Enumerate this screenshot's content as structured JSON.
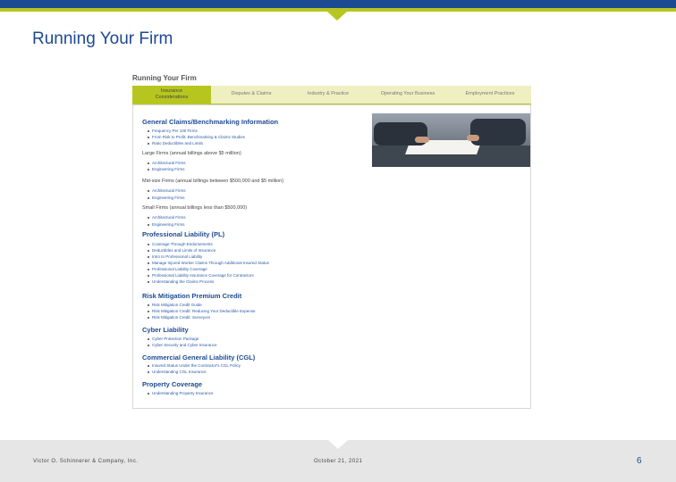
{
  "slide": {
    "title": "Running Your Firm",
    "footer_company": "Victor O. Schinnerer & Company, Inc.",
    "footer_date": "October 21, 2021",
    "page_number": "6"
  },
  "screenshot": {
    "heading": "Running Your Firm",
    "tabs": [
      {
        "label": "Insurance Considerations"
      },
      {
        "label": "Disputes & Claims"
      },
      {
        "label": "Industry & Practice"
      },
      {
        "label": "Operating Your Business"
      },
      {
        "label": "Employment Practices"
      }
    ],
    "sections": {
      "general_claims": {
        "title": "General Claims/Benchmarking Information",
        "items": [
          "Frequency Per 100 Firms",
          "From Risk to Profit: Benchmarking & Claims Studies",
          "Ratio Deductibles and Limits"
        ]
      },
      "large_firms": {
        "title": "Large Firms (annual billings above $5 million)",
        "items": [
          "Architectural Firms",
          "Engineering Firms"
        ]
      },
      "mid_firms": {
        "title": "Mid-size Firms (annual billings between $500,000 and $5 million)",
        "items": [
          "Architectural Firms",
          "Engineering Firms"
        ]
      },
      "small_firms": {
        "title": "Small Firms (annual billings less than $500,000)",
        "items": [
          "Architectural Firms",
          "Engineering Firms"
        ]
      },
      "professional_liability": {
        "title": "Professional Liability (PL)",
        "items": [
          "Coverage Through Endorsements",
          "Deductibles and Limits of Insurance",
          "Intro to Professional Liability",
          "Manage Injured Worker Claims Through Additional Insured Status",
          "Professional Liability Coverage",
          "Professional Liability Insurance Coverage for Contractors",
          "Understanding the Claims Process"
        ]
      },
      "risk_mitigation": {
        "title": "Risk Mitigation Premium Credit",
        "items": [
          "Risk Mitigation Credit Guide",
          "Risk Mitigation Credit: Reducing Your Deductible Expense",
          "Risk Mitigation Credit: Surveyors"
        ]
      },
      "cyber": {
        "title": "Cyber Liability",
        "items": [
          "Cyber Protection Package",
          "Cyber Security and Cyber Insurance"
        ]
      },
      "cgl": {
        "title": "Commercial General Liability (CGL)",
        "items": [
          "Insured Status Under the Contractor's CGL Policy",
          "Understanding CGL Insurance"
        ]
      },
      "property": {
        "title": "Property Coverage",
        "items": [
          "Understanding Property Insurance"
        ]
      }
    }
  }
}
